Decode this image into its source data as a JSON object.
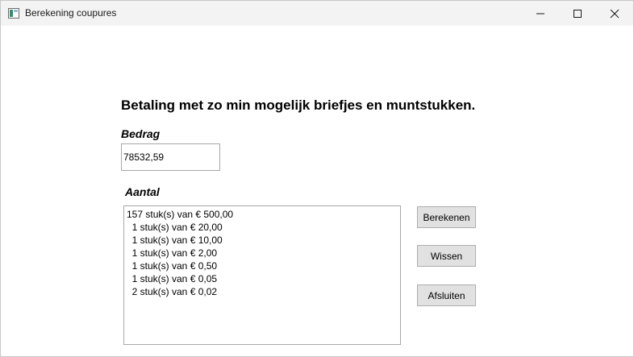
{
  "window": {
    "title": "Berekening coupures"
  },
  "main": {
    "heading": "Betaling met zo min mogelijk briefjes en muntstukken.",
    "amount_label": "Bedrag",
    "amount_value": "78532,59",
    "count_label": "Aantal",
    "results": [
      "157 stuk(s) van € 500,00",
      "  1 stuk(s) van € 20,00",
      "  1 stuk(s) van € 10,00",
      "  1 stuk(s) van € 2,00",
      "  1 stuk(s) van € 0,50",
      "  1 stuk(s) van € 0,05",
      "  2 stuk(s) van € 0,02"
    ]
  },
  "buttons": {
    "calculate": "Berekenen",
    "clear": "Wissen",
    "exit": "Afsluiten"
  }
}
